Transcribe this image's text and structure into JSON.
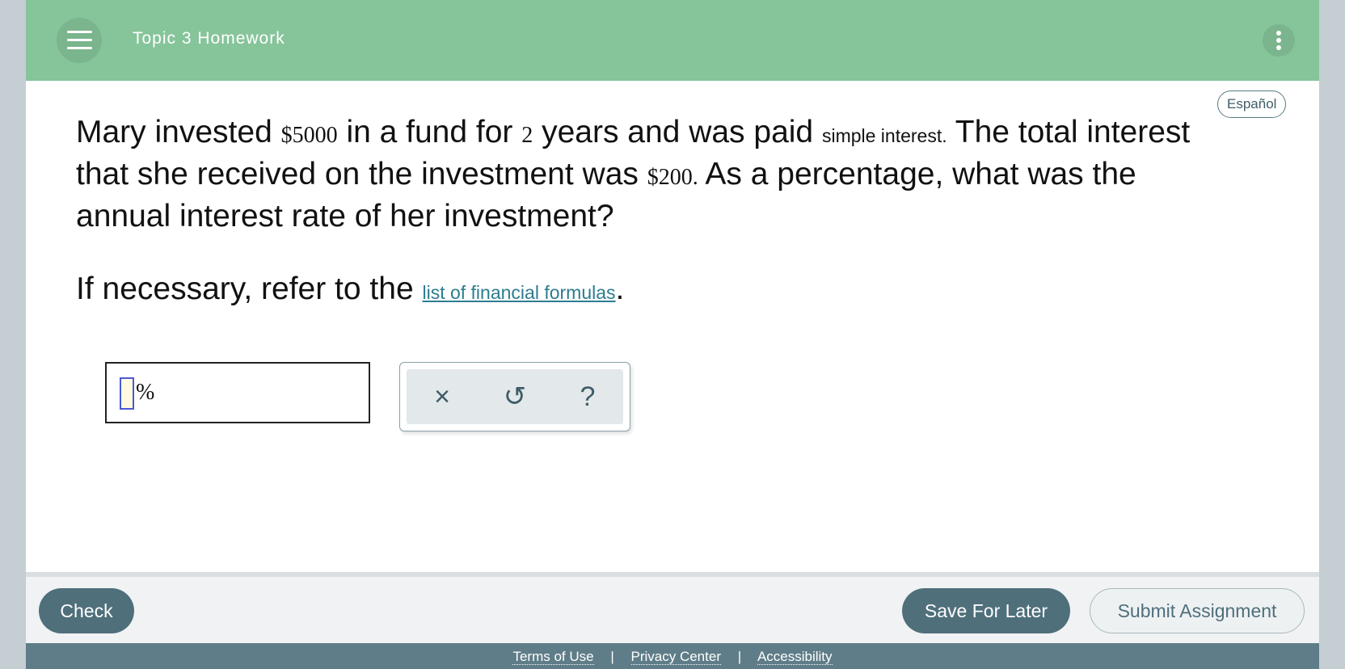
{
  "header": {
    "title": "Topic 3 Homework"
  },
  "language_toggle": "Español",
  "question": {
    "p1": "Mary invested ",
    "principal": "$5000",
    "p2": " in a fund for ",
    "years": "2",
    "p3": " years and was paid ",
    "interest_type": "simple interest.",
    "p4": " The total interest that she received on the investment was ",
    "interest_amount": "$200.",
    "p5": " As a percentage, what was the annual interest rate of her investment?"
  },
  "refer": {
    "prefix": "If necessary, refer to the ",
    "link": "list of financial formulas",
    "suffix": "."
  },
  "answer": {
    "value": "",
    "unit": "%"
  },
  "tools": {
    "clear": "×",
    "undo": "↺",
    "help": "?"
  },
  "footer": {
    "check": "Check",
    "save": "Save For Later",
    "submit": "Submit Assignment"
  },
  "links": {
    "terms": "Terms of Use",
    "privacy": "Privacy Center",
    "accessibility": "Accessibility",
    "separator": "|"
  },
  "colors": {
    "header": "#86c49a",
    "primary_button": "#4f6f7b",
    "link": "#2d7c8f",
    "footer_bar": "#5f7d88"
  },
  "icons": {
    "menu": "hamburger-menu-icon",
    "more": "vertical-dots-icon",
    "clear": "close-icon",
    "undo": "undo-icon",
    "help": "help-icon"
  }
}
